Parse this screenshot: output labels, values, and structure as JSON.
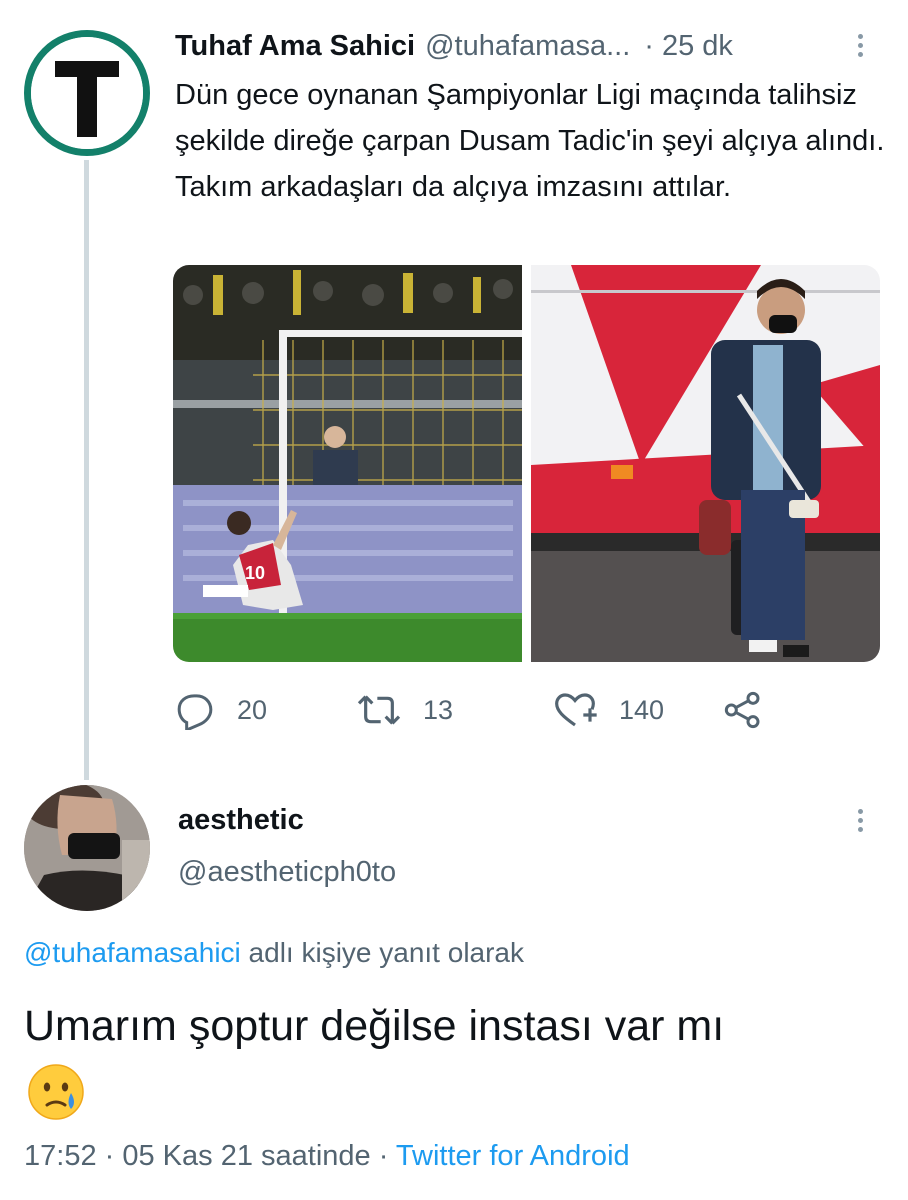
{
  "tweet": {
    "author_name": "Tuhaf Ama Sahici",
    "author_handle": "@tuhafamasa...",
    "time_separator": "·",
    "time": "25 dk",
    "text": "Dün gece oynanan Şampiyonlar Ligi maçında talihsiz şekilde direğe çarpan Dusam Tadic'in şeyi alçıya alındı. Takım arkadaşları da alçıya imzasını attılar.",
    "avatar_letter": "T",
    "actions": {
      "replies": "20",
      "retweets": "13",
      "likes": "140"
    }
  },
  "reply": {
    "author_name": "aesthetic",
    "author_handle": "@aestheticph0to",
    "reply_to_mention": "@tuhafamasahici",
    "reply_to_suffix": " adlı kişiye yanıt olarak",
    "text": "Umarım şoptur değilse instası var mı",
    "emoji": "face-holding-back-tears",
    "time": "17:52",
    "separator": " · ",
    "date": "05 Kas 21 saatinde",
    "separator2": " · ",
    "source": "Twitter for Android"
  },
  "colors": {
    "link": "#1d9bf0",
    "secondary_text": "#536471",
    "primary_text": "#0f1419",
    "avatar_ring": "#13806a"
  }
}
